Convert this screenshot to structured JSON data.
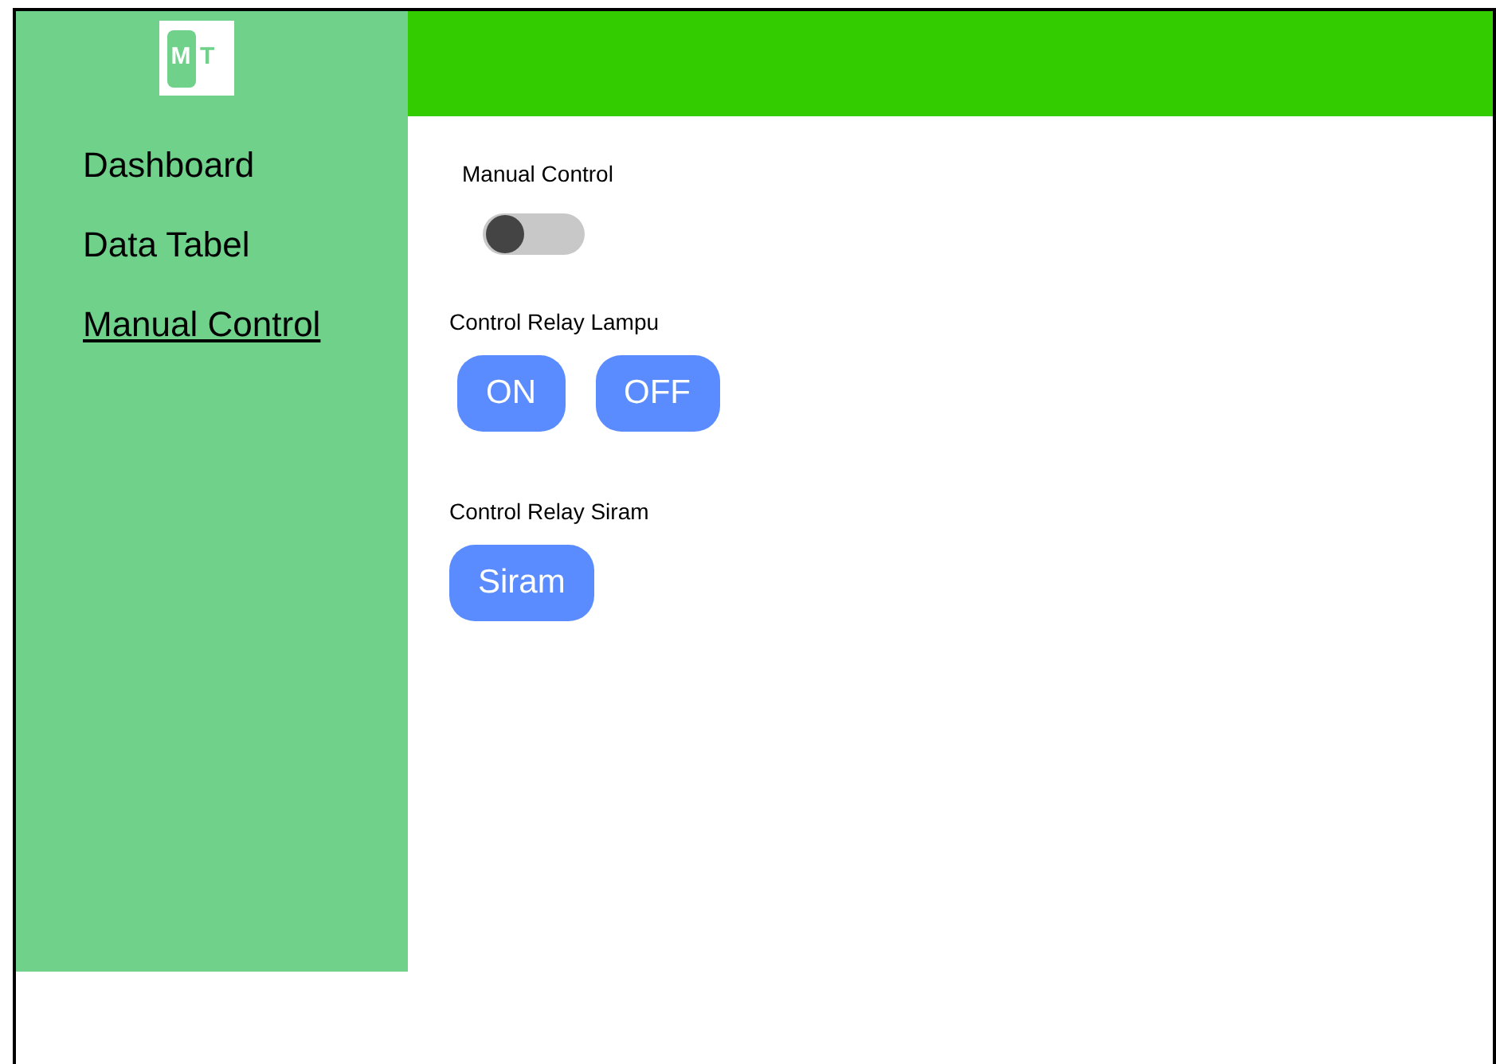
{
  "logo": {
    "letters": [
      "M",
      "T"
    ]
  },
  "sidebar": {
    "items": [
      {
        "label": "Dashboard",
        "selected": false
      },
      {
        "label": "Data Tabel",
        "selected": false
      },
      {
        "label": "Manual Control",
        "selected": true
      }
    ]
  },
  "manual_control": {
    "label": "Manual Control",
    "on": false
  },
  "relay_lampu": {
    "label": "Control Relay Lampu",
    "buttons": [
      "ON",
      "OFF"
    ]
  },
  "relay_siram": {
    "label": "Control Relay Siram",
    "buttons": [
      "Siram"
    ]
  }
}
